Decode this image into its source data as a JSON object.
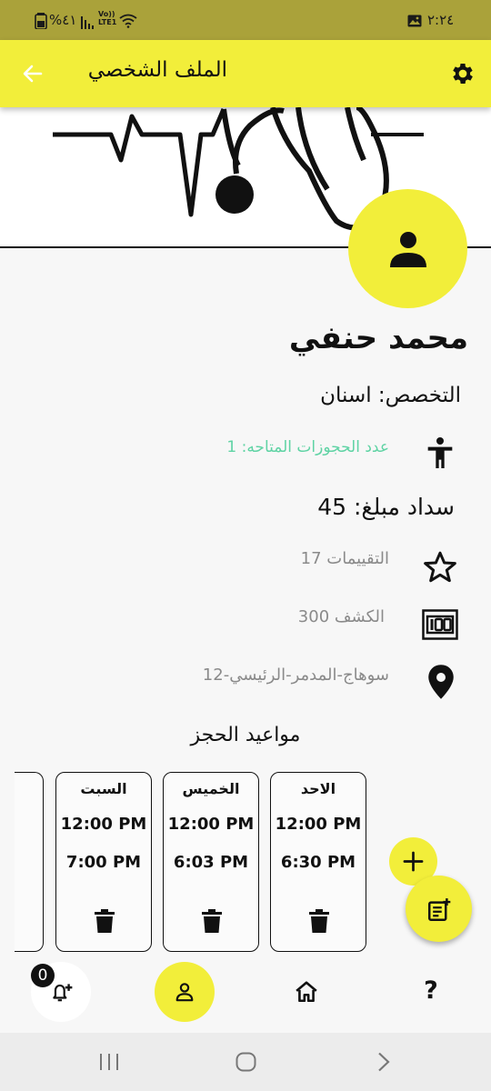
{
  "status_bar": {
    "battery": "%٤١",
    "volte": "Vo)) LTE1",
    "time": "٢:٢٤"
  },
  "app_bar": {
    "title": "الملف الشخصي",
    "back_icon": "arrow-left-icon",
    "settings_icon": "gear-icon"
  },
  "profile": {
    "name": "محمد  حنفي",
    "specialty": "التخصص: اسنان",
    "available_bookings": "عدد الحجوزات المتاحه: 1",
    "payment": "سداد مبلغ: 45",
    "ratings": "التقييمات 17",
    "fee": "الكشف 300",
    "address": "سوهاج-المدمر-الرئيسي-12"
  },
  "schedule": {
    "title": "مواعيد الحجز",
    "days": [
      {
        "day": "الاحد",
        "from": "12:00 PM",
        "to": "6:30 PM"
      },
      {
        "day": "الخميس",
        "from": "12:00 PM",
        "to": "6:03 PM"
      },
      {
        "day": "السبت",
        "from": "12:00 PM",
        "to": "7:00 PM"
      }
    ]
  },
  "bottom_nav": {
    "notification_count": "0",
    "help_label": "?"
  },
  "colors": {
    "accent": "#f2ee3a",
    "status_bar": "#aaa23a",
    "available_text": "#5fd3a4",
    "muted_text": "#8a8a8a"
  }
}
